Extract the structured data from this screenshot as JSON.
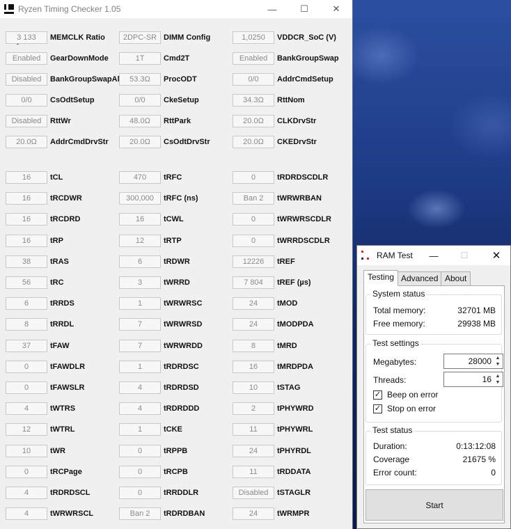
{
  "main_window": {
    "title": "Ryzen Timing Checker 1.05",
    "controls": {
      "minimize": "—",
      "maximize": "☐",
      "close": "✕"
    }
  },
  "top_params": [
    {
      "value": "3 133",
      "label": "MEMCLK Ratio"
    },
    {
      "value": "2DPC-SR",
      "label": "DIMM Config"
    },
    {
      "value": "1,0250",
      "label": "VDDCR_SoC (V)"
    },
    {
      "value": "Enabled",
      "label": "GearDownMode"
    },
    {
      "value": "1T",
      "label": "Cmd2T"
    },
    {
      "value": "Enabled",
      "label": "BankGroupSwap"
    },
    {
      "value": "Disabled",
      "label": "BankGroupSwapAlt"
    },
    {
      "value": "53.3Ω",
      "label": "ProcODT"
    },
    {
      "value": "0/0",
      "label": "AddrCmdSetup"
    },
    {
      "value": "0/0",
      "label": "CsOdtSetup"
    },
    {
      "value": "0/0",
      "label": "CkeSetup"
    },
    {
      "value": "34.3Ω",
      "label": "RttNom"
    },
    {
      "value": "Disabled",
      "label": "RttWr"
    },
    {
      "value": "48.0Ω",
      "label": "RttPark"
    },
    {
      "value": "20.0Ω",
      "label": "CLKDrvStr"
    },
    {
      "value": "20.0Ω",
      "label": "AddrCmdDrvStr"
    },
    {
      "value": "20.0Ω",
      "label": "CsOdtDrvStr"
    },
    {
      "value": "20.0Ω",
      "label": "CKEDrvStr"
    }
  ],
  "timings": [
    {
      "value": "16",
      "label": "tCL"
    },
    {
      "value": "470",
      "label": "tRFC"
    },
    {
      "value": "0",
      "label": "tRDRDSCDLR"
    },
    {
      "value": "16",
      "label": "tRCDWR"
    },
    {
      "value": "300,000",
      "label": "tRFC (ns)"
    },
    {
      "value": "Ban 2",
      "label": "tWRWRBAN"
    },
    {
      "value": "16",
      "label": "tRCDRD"
    },
    {
      "value": "16",
      "label": "tCWL"
    },
    {
      "value": "0",
      "label": "tWRWRSCDLR"
    },
    {
      "value": "16",
      "label": "tRP"
    },
    {
      "value": "12",
      "label": "tRTP"
    },
    {
      "value": "0",
      "label": "tWRRDSCDLR"
    },
    {
      "value": "38",
      "label": "tRAS"
    },
    {
      "value": "6",
      "label": "tRDWR"
    },
    {
      "value": "12226",
      "label": "tREF"
    },
    {
      "value": "56",
      "label": "tRC"
    },
    {
      "value": "3",
      "label": "tWRRD"
    },
    {
      "value": "7 804",
      "label": "tREF (µs)"
    },
    {
      "value": "6",
      "label": "tRRDS"
    },
    {
      "value": "1",
      "label": "tWRWRSC"
    },
    {
      "value": "24",
      "label": "tMOD"
    },
    {
      "value": "8",
      "label": "tRRDL"
    },
    {
      "value": "7",
      "label": "tWRWRSD"
    },
    {
      "value": "24",
      "label": "tMODPDA"
    },
    {
      "value": "37",
      "label": "tFAW"
    },
    {
      "value": "7",
      "label": "tWRWRDD"
    },
    {
      "value": "8",
      "label": "tMRD"
    },
    {
      "value": "0",
      "label": "tFAWDLR"
    },
    {
      "value": "1",
      "label": "tRDRDSC"
    },
    {
      "value": "16",
      "label": "tMRDPDA"
    },
    {
      "value": "0",
      "label": "tFAWSLR"
    },
    {
      "value": "4",
      "label": "tRDRDSD"
    },
    {
      "value": "10",
      "label": "tSTAG"
    },
    {
      "value": "4",
      "label": "tWTRS"
    },
    {
      "value": "4",
      "label": "tRDRDDD"
    },
    {
      "value": "2",
      "label": "tPHYWRD"
    },
    {
      "value": "12",
      "label": "tWTRL"
    },
    {
      "value": "1",
      "label": "tCKE"
    },
    {
      "value": "11",
      "label": "tPHYWRL"
    },
    {
      "value": "10",
      "label": "tWR"
    },
    {
      "value": "0",
      "label": "tRPPB"
    },
    {
      "value": "24",
      "label": "tPHYRDL"
    },
    {
      "value": "0",
      "label": "tRCPage"
    },
    {
      "value": "0",
      "label": "tRCPB"
    },
    {
      "value": "11",
      "label": "tRDDATA"
    },
    {
      "value": "4",
      "label": "tRDRDSCL"
    },
    {
      "value": "0",
      "label": "tRRDDLR"
    },
    {
      "value": "Disabled",
      "label": "tSTAGLR"
    },
    {
      "value": "4",
      "label": "tWRWRSCL"
    },
    {
      "value": "Ban 2",
      "label": "tRDRDBAN"
    },
    {
      "value": "24",
      "label": "tWRMPR"
    }
  ],
  "ram_test": {
    "title": "RAM Test",
    "controls": {
      "minimize": "—",
      "maximize": "☐",
      "close": "✕"
    },
    "tabs": [
      "Testing",
      "Advanced",
      "About"
    ],
    "system_status": {
      "title": "System status",
      "total_label": "Total memory:",
      "total_value": "32701 MB",
      "free_label": "Free memory:",
      "free_value": "29938 MB"
    },
    "test_settings": {
      "title": "Test settings",
      "megabytes_label": "Megabytes:",
      "megabytes_value": "28000",
      "threads_label": "Threads:",
      "threads_value": "16",
      "beep_label": "Beep on error",
      "beep_checked": true,
      "stop_label": "Stop on error",
      "stop_checked": true
    },
    "test_status": {
      "title": "Test status",
      "duration_label": "Duration:",
      "duration_value": "0:13:12:08",
      "coverage_label": "Coverage",
      "coverage_value": "21675 %",
      "errors_label": "Error count:",
      "errors_value": "0"
    },
    "start_label": "Start"
  }
}
